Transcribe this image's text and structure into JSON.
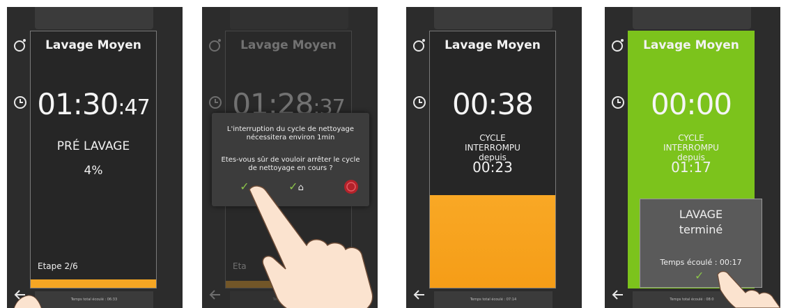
{
  "screens": [
    {
      "title": "Lavage Moyen",
      "time_main": "01:30",
      "time_sec": ":47",
      "phase": "PRÉ LAVAGE",
      "percent": "4%",
      "step": "Etape 2/6",
      "footer": "Temps total écoulé : 06:33"
    },
    {
      "title": "Lavage Moyen",
      "time_main": "01:28",
      "time_sec": ":37",
      "step": "Eta",
      "dialog_line1": "L'interruption du cycle de nettoyage nécessitera environ 1min",
      "dialog_line2": "Etes-vous sûr de vouloir arrêter le cycle de nettoyage en cours ?",
      "footer": "Temps total écoulé"
    },
    {
      "title": "Lavage Moyen",
      "time_main": "00:38",
      "status1": "CYCLE",
      "status2": "INTERROMPU",
      "status3": "depuis",
      "since": "00:23",
      "footer": "Temps total écoulé : 07:14"
    },
    {
      "title": "Lavage Moyen",
      "time_main": "00:00",
      "status1": "CYCLE",
      "status2": "INTERROMPU",
      "status3": "depuis",
      "since": "01:17",
      "done_line1": "LAVAGE",
      "done_line2": "terminé",
      "elapsed": "Temps écoulé : 00:17",
      "footer": "Temps total écoulé : 08:0"
    }
  ],
  "progress": {
    "screen1_strip": 1.0,
    "screen3_fill": 0.36
  },
  "icons": {
    "timer": "timer-icon",
    "clock": "clock-icon",
    "back": "back-arrow-icon",
    "check": "check-icon",
    "home": "home-icon",
    "cancel": "cancel-icon"
  },
  "colors": {
    "panel_bg": "#2c2c2c",
    "orange": "#f5a623",
    "green": "#7cc31c",
    "cancel_red": "#b3222a"
  }
}
